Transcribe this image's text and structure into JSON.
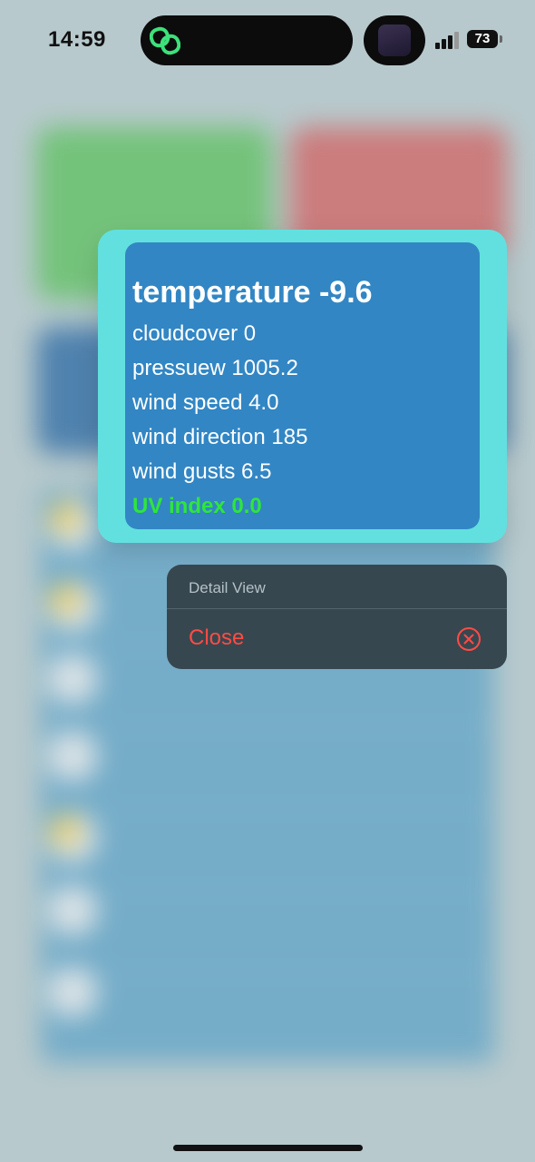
{
  "status_bar": {
    "time": "14:59",
    "battery": "73"
  },
  "detail": {
    "title": "temperature -9.6",
    "lines": [
      "cloudcover 0",
      "pressuew 1005.2",
      "wind speed 4.0",
      "wind direction 185",
      "wind gusts 6.5"
    ],
    "uv": "UV index 0.0"
  },
  "menu": {
    "header": "Detail View",
    "items": [
      {
        "label": "Close",
        "icon": "close-circle-icon"
      }
    ]
  },
  "colors": {
    "accent_teal": "#62e0df",
    "card_blue": "#3286c4",
    "uv_green": "#2ee63a",
    "menu_bg": "#37474f",
    "destructive_red": "#ff4b45"
  }
}
